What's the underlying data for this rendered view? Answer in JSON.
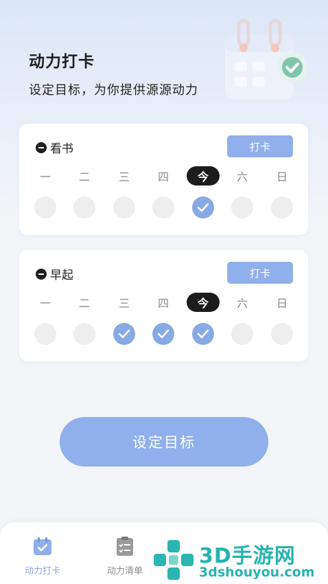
{
  "header": {
    "title": "动力打卡",
    "subtitle": "设定目标，为你提供源源动力"
  },
  "week_labels": [
    "一",
    "二",
    "三",
    "四",
    "今",
    "六",
    "日"
  ],
  "habits": [
    {
      "name": "看书",
      "button_label": "打卡",
      "checked": [
        false,
        false,
        false,
        false,
        true,
        false,
        false
      ]
    },
    {
      "name": "早起",
      "button_label": "打卡",
      "checked": [
        false,
        false,
        true,
        true,
        true,
        false,
        false
      ]
    }
  ],
  "set_goal_button": "设定目标",
  "tabbar": {
    "items": [
      {
        "label": "动力打卡",
        "icon": "calendar-check-icon",
        "active": true
      },
      {
        "label": "动力清单",
        "icon": "checklist-icon",
        "active": false
      }
    ]
  },
  "watermark": {
    "brand": "3D手游网",
    "url": "3dshouyou.com"
  },
  "colors": {
    "accent": "#8fb0ea",
    "today": "#1c1c1c",
    "done": "#87a9e4"
  }
}
